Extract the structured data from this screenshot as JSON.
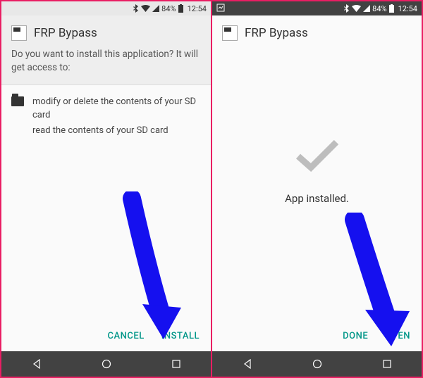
{
  "status": {
    "battery": "84%",
    "time": "12:54"
  },
  "left_screen": {
    "title": "FRP Bypass",
    "prompt": "Do you want to install this application? It will get access to:",
    "permission1": "modify or delete the contents of your SD card",
    "permission2": "read the contents of your SD card",
    "cancel": "CANCEL",
    "install": "INSTALL"
  },
  "right_screen": {
    "title": "FRP Bypass",
    "installed": "App installed.",
    "done": "DONE",
    "open": "OPEN"
  }
}
